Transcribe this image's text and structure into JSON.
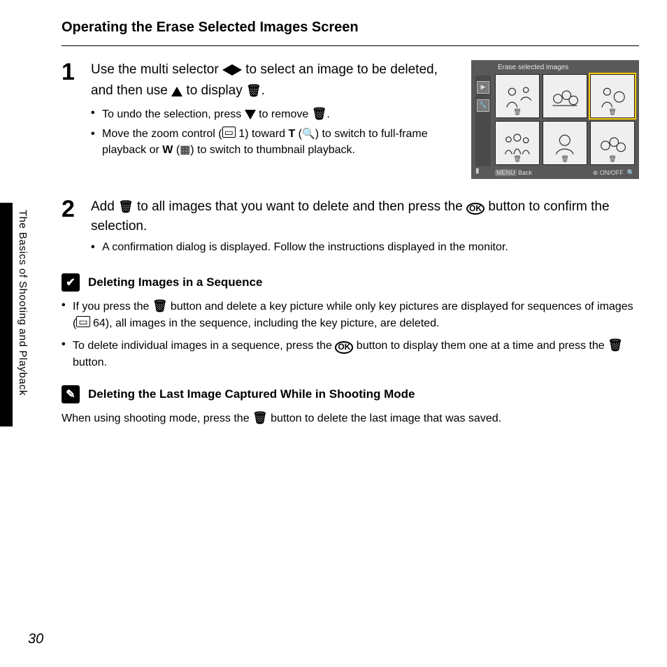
{
  "title": "Operating the Erase Selected Images Screen",
  "side_label": "The Basics of Shooting and Playback",
  "page_number": "30",
  "steps": {
    "s1": {
      "num": "1",
      "line_a": "Use the multi selector ",
      "line_b": " to select an image to be deleted, and then use ",
      "line_c": " to display ",
      "bul1_a": "To undo the selection, press ",
      "bul1_b": " to remove ",
      "bul2_a": "Move the zoom control (",
      "bul2_b": " 1) toward ",
      "bul2_c": ") to switch to full-frame playback or ",
      "bul2_d": ") to switch to thumbnail playback.",
      "dot": "."
    },
    "s2": {
      "num": "2",
      "line_a": "Add ",
      "line_b": " to all images that you want to delete and then press the ",
      "line_c": " button to confirm the selection.",
      "bul1": "A confirmation dialog is displayed. Follow the instructions displayed in the monitor."
    }
  },
  "lcd": {
    "title": "Erase selected images",
    "back": "Back",
    "onoff": "ON/OFF"
  },
  "callout1": {
    "heading": "Deleting Images in a Sequence",
    "li1_a": "If you press the ",
    "li1_b": " button and delete a key picture while only key pictures are displayed for sequences of images (",
    "li1_c": " 64), all images in the sequence, including the key picture, are deleted.",
    "li2_a": "To delete individual images in a sequence, press the ",
    "li2_b": " button to display them one at a time and press the ",
    "li2_c": " button."
  },
  "callout2": {
    "heading": "Deleting the Last Image Captured While in Shooting Mode",
    "body_a": "When using shooting mode, press the ",
    "body_b": " button to delete the last image that was saved."
  },
  "glyphs": {
    "T": "T",
    "W": "W",
    "OK": "OK",
    "play": "▶",
    "wrench": "🔧",
    "menu": "MENU"
  }
}
